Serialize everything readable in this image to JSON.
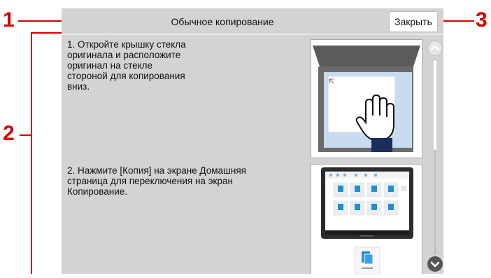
{
  "callouts": {
    "one": "1",
    "two": "2",
    "three": "3"
  },
  "header": {
    "title": "Обычное копирование",
    "close_label": "Закрыть"
  },
  "steps": [
    {
      "text": "1. Откройте крышку стекла\nоригинала и расположите\nоригинал на стекле\nстороной для копирования\nвниз."
    },
    {
      "text": "2. Нажмите [Копия] на экране Домашняя\nстраница для переключения на экран\nКопирование."
    }
  ],
  "icons": {
    "scroll_up": "chevron-up-icon",
    "scroll_down": "chevron-down-icon"
  },
  "colors": {
    "callout": "#d60000",
    "panel": "#d3d3d3",
    "accent": "#1f8fd2"
  }
}
